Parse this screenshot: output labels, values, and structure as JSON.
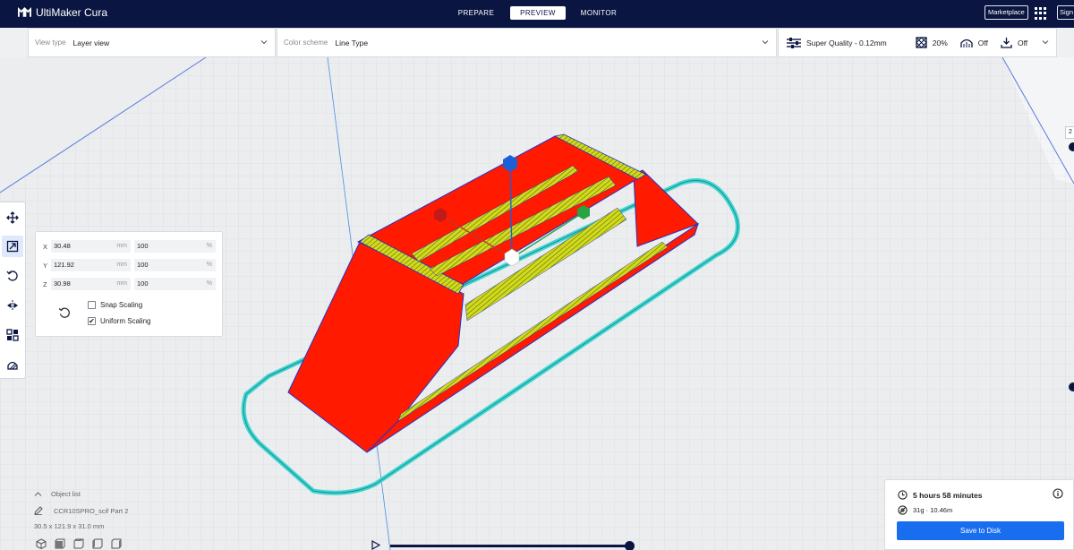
{
  "app": {
    "title": "UltiMaker Cura",
    "stages": [
      "PREPARE",
      "PREVIEW",
      "MONITOR"
    ],
    "active_stage": "PREVIEW",
    "marketplace_label": "Marketplace",
    "signin_label": "Sign"
  },
  "view_bar": {
    "view_type_label": "View type",
    "view_type_value": "Layer view",
    "color_scheme_label": "Color scheme",
    "color_scheme_value": "Line Type"
  },
  "print_settings": {
    "profile": "Super Quality - 0.12mm",
    "infill": "20%",
    "support": "Off",
    "adhesion": "Off"
  },
  "toolbar": {
    "icons": [
      "move-icon",
      "scale-icon",
      "rotate-icon",
      "mirror-icon",
      "per-model-settings-icon",
      "support-blocker-icon"
    ],
    "active": "scale-icon"
  },
  "scale_panel": {
    "rows": [
      {
        "axis": "X",
        "mm": "30.48",
        "percent": "100"
      },
      {
        "axis": "Y",
        "mm": "121.92",
        "percent": "100"
      },
      {
        "axis": "Z",
        "mm": "30.98",
        "percent": "100"
      }
    ],
    "mm_unit": "mm",
    "percent_unit": "%",
    "snap_scaling_label": "Snap Scaling",
    "snap_scaling_checked": false,
    "uniform_scaling_label": "Uniform Scaling",
    "uniform_scaling_checked": true
  },
  "object_list": {
    "header": "Object list",
    "object_name": "CCR10SPRO_scif Part 2",
    "dimensions": "30.5 x 121.9 x 31.0 mm"
  },
  "layer_slider": {
    "top_layer_label": "2"
  },
  "print_info": {
    "time": "5 hours 58 minutes",
    "material": "31g · 10.46m",
    "save_label": "Save to Disk"
  },
  "colors": {
    "header_bg": "#0a1541",
    "accent": "#196ef0",
    "wall_red": "#ff1a00",
    "infill_yellow": "#e6e61a",
    "skirt_cyan": "#3fd6d3",
    "outline_blue": "#2233cc"
  }
}
